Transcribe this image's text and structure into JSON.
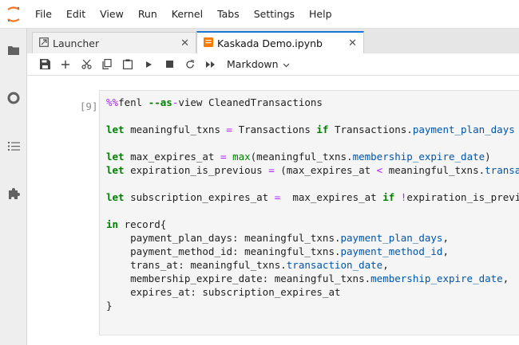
{
  "menubar": {
    "items": [
      "File",
      "Edit",
      "View",
      "Run",
      "Kernel",
      "Tabs",
      "Settings",
      "Help"
    ]
  },
  "tabs": [
    {
      "label": "Launcher",
      "icon": "launcher-icon",
      "active": false
    },
    {
      "label": "Kaskada Demo.ipynb",
      "icon": "notebook-icon",
      "active": true
    }
  ],
  "toolbar": {
    "cell_type": "Markdown"
  },
  "cell": {
    "prompt": "[9]:",
    "lines": [
      "%%fenl --as-view CleanedTransactions",
      "",
      "let meaningful_txns = Transactions if Transactions.payment_plan_days",
      "",
      "let max_expires_at = max(meaningful_txns.membership_expire_date)",
      "let expiration_is_previous = (max_expires_at < meaningful_txns.transa",
      "",
      "let subscription_expires_at =  max_expires_at if !expiration_is_previ",
      "",
      "in record{",
      "    payment_plan_days: meaningful_txns.payment_plan_days,",
      "    payment_method_id: meaningful_txns.payment_method_id,",
      "    trans_at: meaningful_txns.transaction_date,",
      "    membership_expire_date: meaningful_txns.membership_expire_date,",
      "    expires_at: subscription_expires_at",
      "}"
    ]
  },
  "colors": {
    "accent": "#1976d2",
    "notebook_icon": "#f57c00",
    "keyword": "#008000",
    "magic": "#aa22ff",
    "property": "#0055aa"
  }
}
